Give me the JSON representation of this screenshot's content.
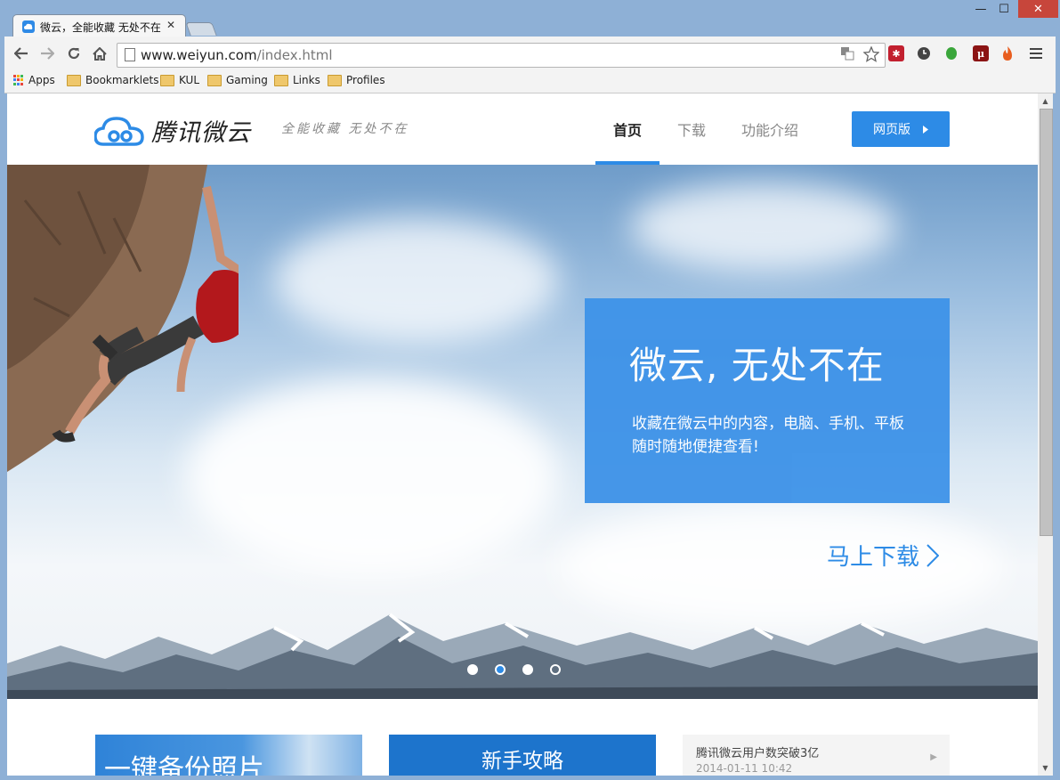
{
  "browser": {
    "tab_title": "微云，全能收藏 无处不在",
    "tab_close": "✕",
    "url_host": "www.weiyun.com",
    "url_path": "/index.html",
    "window_controls": {
      "minimize": "—",
      "maximize": "☐",
      "close": "✕"
    },
    "bookmarks": [
      {
        "label": "Apps",
        "icon": "apps-grid-icon"
      },
      {
        "label": "Bookmarklets",
        "icon": "folder-icon"
      },
      {
        "label": "KUL",
        "icon": "folder-icon"
      },
      {
        "label": "Gaming",
        "icon": "folder-icon"
      },
      {
        "label": "Links",
        "icon": "folder-icon"
      },
      {
        "label": "Profiles",
        "icon": "folder-icon"
      }
    ]
  },
  "site": {
    "logo_name": "腾讯微云",
    "tagline": "全能收藏  无处不在",
    "nav": [
      {
        "label": "首页",
        "active": true
      },
      {
        "label": "下载",
        "active": false
      },
      {
        "label": "功能介绍",
        "active": false
      }
    ],
    "web_button": "网页版",
    "accent_color": "#2d8be6"
  },
  "hero": {
    "title": "微云, 无处不在",
    "text": "收藏在微云中的内容，电脑、手机、平板随时随地便捷查看!",
    "download_link": "马上下载",
    "slides": 4,
    "active_slide": 2
  },
  "cards": {
    "photo_backup": "一键备份照片",
    "guide": "新手攻略",
    "news_title": "腾讯微云用户数突破3亿",
    "news_date": "2014-01-11 10:42"
  }
}
